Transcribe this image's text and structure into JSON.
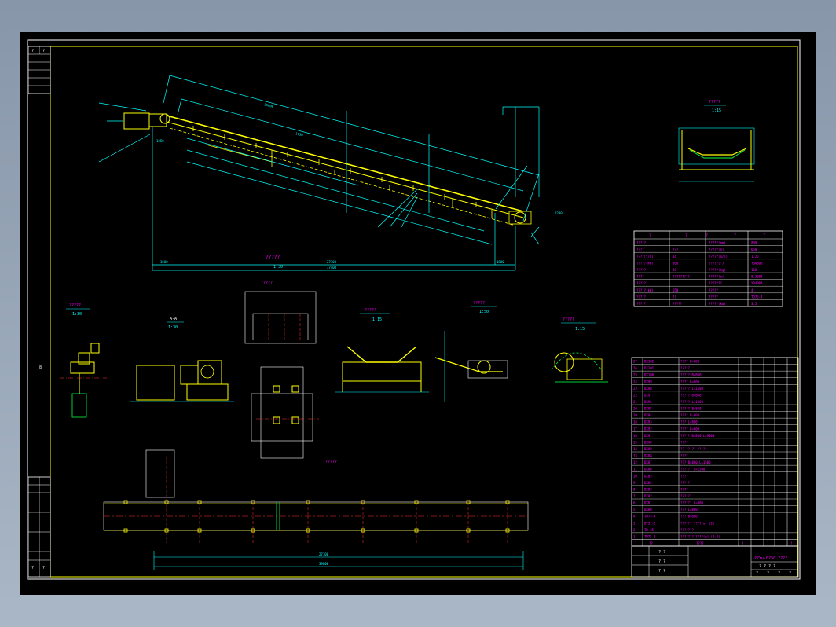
{
  "colors": {
    "background": "#000000",
    "border": "#ffffff",
    "frame": "#ffff00",
    "dimension": "#00ffff",
    "text": "#ff00ff",
    "part": "#ffff00",
    "centerline": "#ff3333",
    "motor": "#00cc33"
  },
  "titles": {
    "main_scale": "1:30",
    "head_view_scale": "1:15",
    "drive_title_scale": "1:30",
    "drive_scale": "1:30",
    "roller_scale": "1:15",
    "tail_scale": "1:50",
    "tail2_scale": "1:15"
  },
  "main_dims": {
    "total_length": "39800",
    "incline_len": "37400",
    "span": "27100",
    "dim_1500_left": "1500",
    "dim_1800_right": "1800",
    "elev_1650": "1650",
    "dim_1250": "1250",
    "height_right": "2200"
  },
  "spec_table": {
    "headers": [
      "?",
      "?",
      "?",
      "?",
      "?"
    ],
    "rows": [
      [
        "?????",
        "",
        "?????(mm)",
        "800"
      ],
      [
        "????",
        "???",
        "?????(m)",
        "650"
      ],
      [
        "????(t/h)",
        "14",
        "?????(m/s)",
        "1.25"
      ],
      [
        "?????(mm)",
        "800",
        "?????(°)",
        "YB4800"
      ],
      [
        "?????",
        "30",
        "?????(kg)",
        "160"
      ],
      [
        "????",
        "?????????",
        "?????(m)",
        "8.3000"
      ],
      [
        "??????",
        "",
        "???????",
        "YB4004"
      ],
      [
        "?????(kW)",
        "550",
        "?????",
        "4"
      ],
      [
        "?????",
        "??",
        "?????",
        "TD75-4"
      ],
      [
        "?????",
        "?????",
        "?????(kw)",
        "3.5"
      ]
    ]
  },
  "bom": {
    "rows": [
      [
        "1",
        "TD75-3",
        "??????? ????(m) (0.8)"
      ],
      [
        "2",
        "TD-35",
        "???????"
      ],
      [
        "3",
        "DTII-2",
        "?????? ????(m) (2)"
      ],
      [
        "4",
        "TD75-4",
        "??? B=800"
      ],
      [
        "5",
        "DX80",
        "??? L=800"
      ],
      [
        "6",
        "DX81",
        "?????? L=800"
      ],
      [
        "7",
        "DX82",
        "??????"
      ],
      [
        "8",
        "DX83",
        "????"
      ],
      [
        "9",
        "DX84",
        "?????"
      ],
      [
        "10",
        "DX85",
        "????"
      ],
      [
        "11",
        "DX86",
        "?????? L=1500"
      ],
      [
        "12",
        "DX87",
        "??? B=800 L=1500"
      ],
      [
        "13",
        "DX88",
        "????"
      ],
      [
        "14",
        "DX89",
        "?? ?? ?? ?? ??"
      ],
      [
        "15",
        "DX90",
        "????"
      ],
      [
        "16",
        "DX91",
        "????? B=800 L=9000"
      ],
      [
        "17",
        "DX92",
        "???? B=800"
      ],
      [
        "18",
        "DX93",
        "??? L=800"
      ],
      [
        "19",
        "DX94",
        "???? B=800"
      ],
      [
        "20",
        "DX95",
        "????? B=800"
      ],
      [
        "21",
        "DX96",
        "????? L=1000"
      ],
      [
        "22",
        "DX97",
        "????? B=800"
      ],
      [
        "23",
        "DX98",
        "????? L=1500"
      ],
      [
        "24",
        "DX99",
        "???? B=800"
      ],
      [
        "25",
        "DX100",
        "????? B=800"
      ],
      [
        "26",
        "DX101",
        "?????"
      ],
      [
        "27",
        "DX102",
        "???? B=800"
      ]
    ],
    "footer": [
      "?",
      "??",
      "????",
      "?",
      "?",
      "?"
    ]
  },
  "title_block": {
    "drawing_code": "??Yu-0?50  ????",
    "scale_row": "? ?  ? ?",
    "rev_marks": [
      "?",
      "?",
      "?",
      "?"
    ],
    "left_stamps": [
      "? ?",
      "? ?",
      "? ?"
    ]
  },
  "side_stamp": {
    "top": [
      "?",
      "?"
    ],
    "bottom": [
      "?",
      "?"
    ]
  },
  "question_marks": "?????",
  "section_marks": {
    "drive_base": "?????",
    "plan": "?????",
    "section_a": "A-A",
    "mark_8": "8"
  }
}
